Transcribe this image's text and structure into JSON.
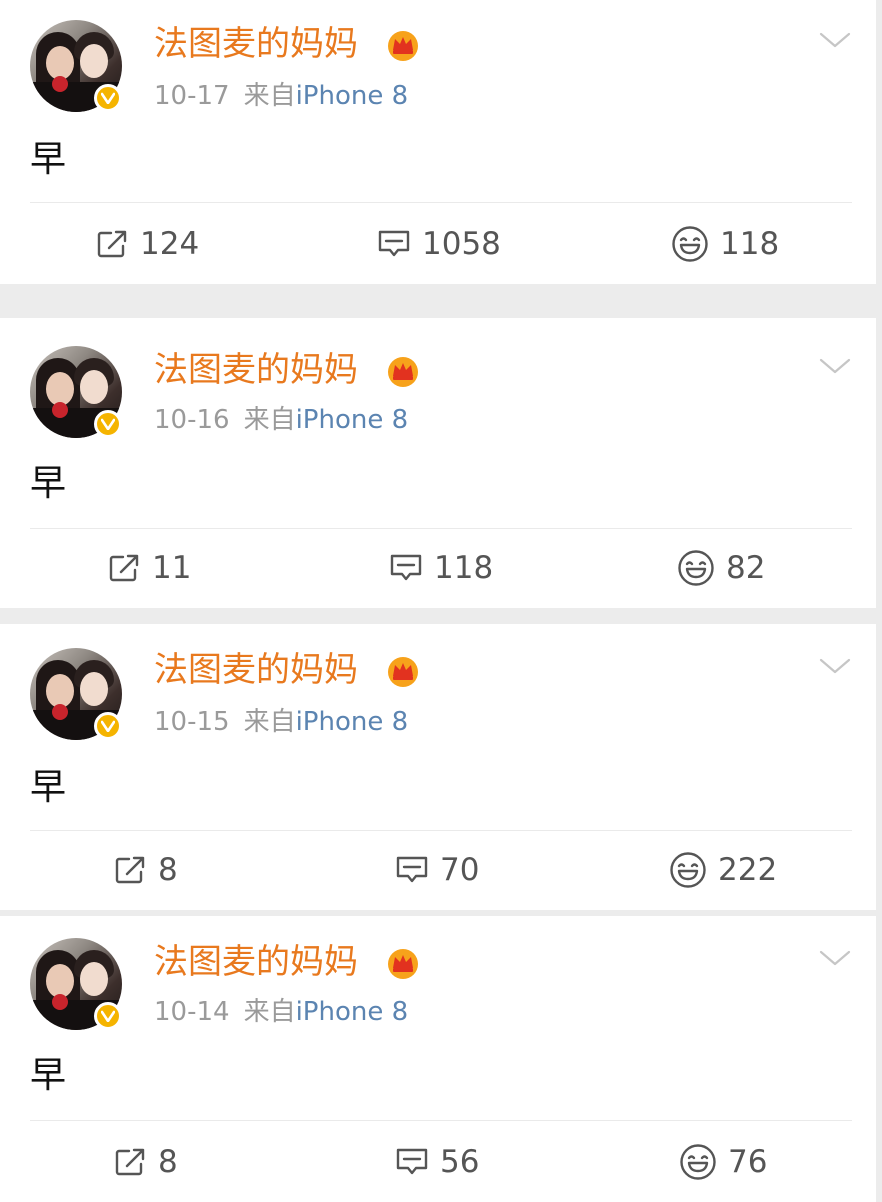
{
  "colors": {
    "username": "#e8791e",
    "device_link": "#5b84b1",
    "meta_gray": "#9a9a9a",
    "verified_badge": "#f5b400",
    "feed_background": "#ececec"
  },
  "icons": {
    "repost": "repost-icon",
    "comment": "comment-icon",
    "like": "smile-like-icon",
    "menu": "chevron-down-icon",
    "verified": "verified-v-badge-icon",
    "member": "crown-member-icon"
  },
  "posts": [
    {
      "username": "法图麦的妈妈",
      "date": "10-17",
      "from_label": "来自",
      "device": "iPhone 8",
      "text": "早",
      "reposts": "124",
      "comments": "1058",
      "likes": "118"
    },
    {
      "username": "法图麦的妈妈",
      "date": "10-16",
      "from_label": "来自",
      "device": "iPhone 8",
      "text": "早",
      "reposts": "11",
      "comments": "118",
      "likes": "82"
    },
    {
      "username": "法图麦的妈妈",
      "date": "10-15",
      "from_label": "来自",
      "device": "iPhone 8",
      "text": "早",
      "reposts": "8",
      "comments": "70",
      "likes": "222"
    },
    {
      "username": "法图麦的妈妈",
      "date": "10-14",
      "from_label": "来自",
      "device": "iPhone 8",
      "text": "早",
      "reposts": "8",
      "comments": "56",
      "likes": "76"
    }
  ]
}
